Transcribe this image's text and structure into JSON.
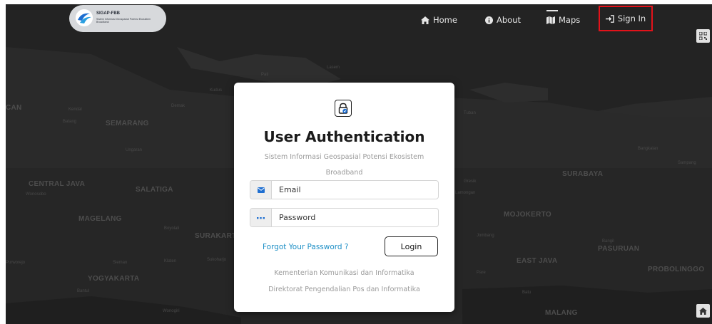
{
  "app": {
    "name": "SIGAP-FBB",
    "tagline": "Sistem Informasi Geospasial Potensi Ekosistem Broadband"
  },
  "nav": {
    "items": [
      {
        "label": "Home",
        "icon": "home-icon"
      },
      {
        "label": "About",
        "icon": "info-icon"
      },
      {
        "label": "Maps",
        "icon": "map-icon"
      },
      {
        "label": "Sign In",
        "icon": "sign-in-icon"
      }
    ],
    "active": "Sign In",
    "highlight_color": "#e3121a"
  },
  "map": {
    "labels": [
      "SEMARANG",
      "CENTRAL JAVA",
      "SALATIGA",
      "MAGELANG",
      "SURAKARTA",
      "YOGYAKARTA",
      "SURABAYA",
      "MOJOKERTO",
      "EAST JAVA",
      "PASURUAN",
      "PROBOLINGGO",
      "MALANG",
      "CAN"
    ],
    "small_labels": [
      "Kendal",
      "Demak",
      "Pati",
      "Lasem",
      "Kudus",
      "Ungaran",
      "Batang",
      "Wonosobo",
      "Boyolali",
      "Klaten",
      "Sleman",
      "Sukoharjo",
      "Wonogiri",
      "Tuban",
      "Gresik",
      "Lamongan",
      "Jombang",
      "Pare",
      "Batu",
      "Bangil",
      "Sampang",
      "Bangkalan",
      "Purworejo",
      "Bantul"
    ]
  },
  "side_buttons": {
    "top_icon": "qr-code-icon",
    "bottom_icon": "home-icon"
  },
  "auth": {
    "icon": "lock-icon",
    "title": "User Authentication",
    "subtitle": "Sistem Informasi Geospasial Potensi Ekosistem Broadband",
    "email_placeholder": "Email",
    "email_icon": "envelope-icon",
    "password_placeholder": "Password",
    "password_icon": "dots-icon",
    "forgot_label": "Forgot Your Password ?",
    "login_label": "Login",
    "footer_line1": "Kementerian Komunikasi dan Informatika",
    "footer_line2": "Direktorat Pengendalian Pos dan Informatika"
  },
  "colors": {
    "map_bg": "#232323",
    "link": "#1d8fc6",
    "accent_icon": "#1f6fd1"
  }
}
